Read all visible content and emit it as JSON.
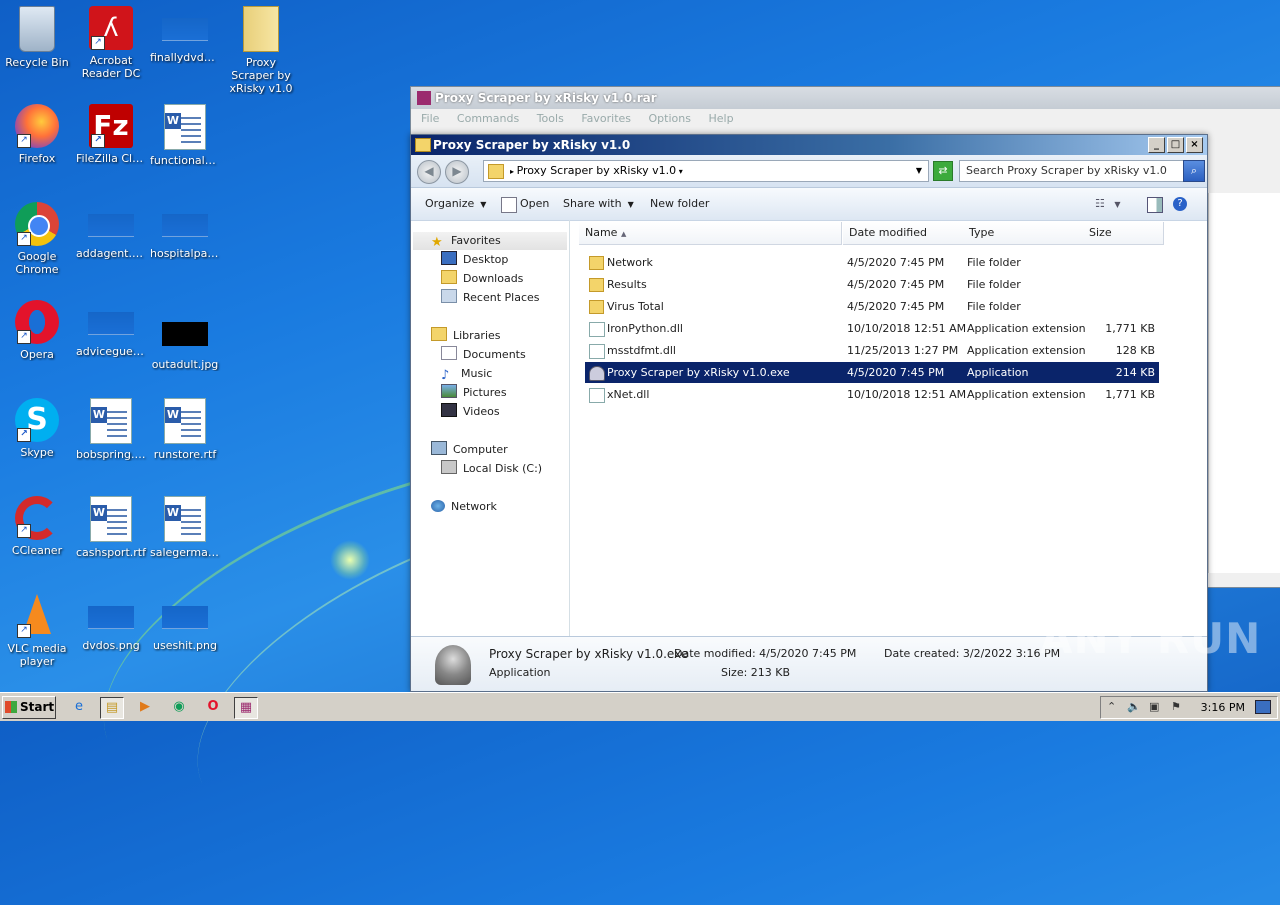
{
  "desktop": {
    "icons": [
      {
        "label": "Recycle Bin"
      },
      {
        "label": "Acrobat Reader DC"
      },
      {
        "label": "finallydvds...."
      },
      {
        "label": "Proxy Scraper by xRisky v1.0"
      },
      {
        "label": "Firefox"
      },
      {
        "label": "FileZilla Client"
      },
      {
        "label": "functionalu..."
      },
      {
        "label": "Google Chrome"
      },
      {
        "label": "addagent.png"
      },
      {
        "label": "hospitalpart..."
      },
      {
        "label": "Opera"
      },
      {
        "label": "advicegues..."
      },
      {
        "label": "outadult.jpg"
      },
      {
        "label": "Skype"
      },
      {
        "label": "bobspring.rtf"
      },
      {
        "label": "runstore.rtf"
      },
      {
        "label": "CCleaner"
      },
      {
        "label": "cashsport.rtf"
      },
      {
        "label": "salegerman.rtf"
      },
      {
        "label": "VLC media player"
      },
      {
        "label": "dvdos.png"
      },
      {
        "label": "useshit.png"
      }
    ]
  },
  "winrar": {
    "title": "Proxy Scraper by xRisky v1.0.rar",
    "menu": [
      "File",
      "Commands",
      "Tools",
      "Favorites",
      "Options",
      "Help"
    ]
  },
  "explorer": {
    "title": "Proxy Scraper by xRisky v1.0",
    "address": "Proxy Scraper by xRisky v1.0",
    "search_placeholder": "Search Proxy Scraper by xRisky v1.0",
    "toolbar": {
      "organize": "Organize",
      "open": "Open",
      "share_with": "Share with",
      "new_folder": "New folder"
    },
    "nav": {
      "favorites": "Favorites",
      "desktop": "Desktop",
      "downloads": "Downloads",
      "recent_places": "Recent Places",
      "libraries": "Libraries",
      "documents": "Documents",
      "music": "Music",
      "pictures": "Pictures",
      "videos": "Videos",
      "computer": "Computer",
      "local_disk": "Local Disk (C:)",
      "network": "Network"
    },
    "columns": {
      "name": "Name",
      "date": "Date modified",
      "type": "Type",
      "size": "Size"
    },
    "files": [
      {
        "name": "Network",
        "date": "4/5/2020 7:45 PM",
        "type": "File folder",
        "size": ""
      },
      {
        "name": "Results",
        "date": "4/5/2020 7:45 PM",
        "type": "File folder",
        "size": ""
      },
      {
        "name": "Virus Total",
        "date": "4/5/2020 7:45 PM",
        "type": "File folder",
        "size": ""
      },
      {
        "name": "IronPython.dll",
        "date": "10/10/2018 12:51 AM",
        "type": "Application extension",
        "size": "1,771 KB"
      },
      {
        "name": "msstdfmt.dll",
        "date": "11/25/2013 1:27 PM",
        "type": "Application extension",
        "size": "128 KB"
      },
      {
        "name": "Proxy Scraper by xRisky v1.0.exe",
        "date": "4/5/2020 7:45 PM",
        "type": "Application",
        "size": "214 KB"
      },
      {
        "name": "xNet.dll",
        "date": "10/10/2018 12:51 AM",
        "type": "Application extension",
        "size": "1,771 KB"
      }
    ],
    "details": {
      "filename": "Proxy Scraper by xRisky v1.0.exe",
      "filetype": "Application",
      "date_modified": "Date modified: 4/5/2020 7:45 PM",
      "size": "Size: 213 KB",
      "date_created": "Date created: 3/2/2022 3:16 PM"
    }
  },
  "taskbar": {
    "start": "Start",
    "clock": "3:16 PM"
  },
  "watermark": "ANY RUN"
}
